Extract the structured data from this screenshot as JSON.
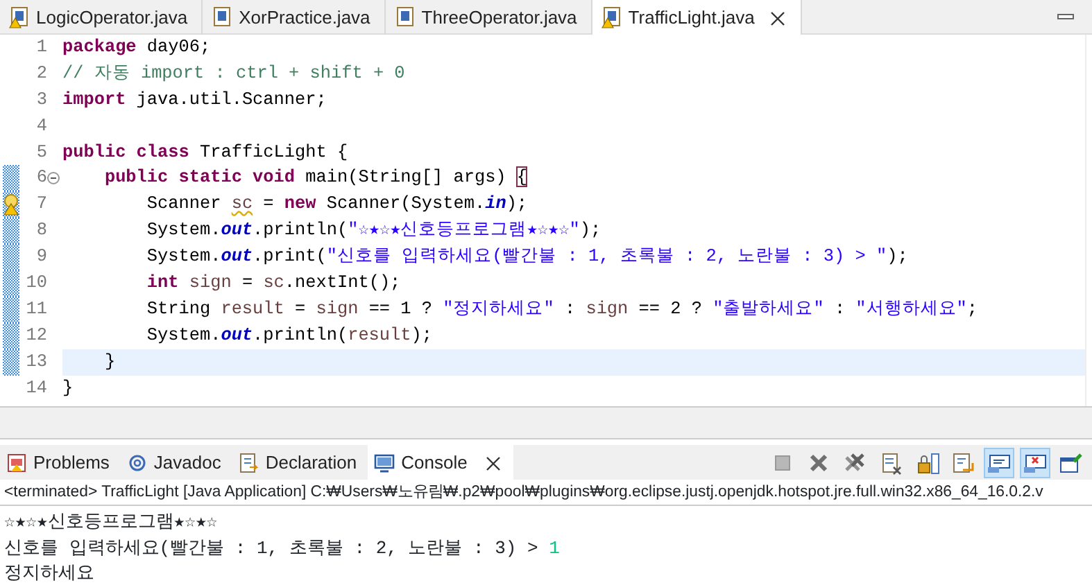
{
  "editor_tabs": [
    {
      "label": "LogicOperator.java",
      "warning": true,
      "selected": false,
      "closable": false
    },
    {
      "label": "XorPractice.java",
      "warning": false,
      "selected": false,
      "closable": false
    },
    {
      "label": "ThreeOperator.java",
      "warning": false,
      "selected": false,
      "closable": false
    },
    {
      "label": "TrafficLight.java",
      "warning": true,
      "selected": true,
      "closable": true
    }
  ],
  "code_lines": [
    {
      "number": "1",
      "changed": false,
      "current": false,
      "tokens": [
        {
          "kind": "keyword",
          "text": "package"
        },
        {
          "kind": "plain",
          "text": " day06;"
        }
      ]
    },
    {
      "number": "2",
      "changed": false,
      "current": false,
      "tokens": [
        {
          "kind": "comment",
          "text": "// 자동 import : ctrl + shift + 0"
        }
      ]
    },
    {
      "number": "3",
      "changed": false,
      "current": false,
      "tokens": [
        {
          "kind": "keyword",
          "text": "import"
        },
        {
          "kind": "plain",
          "text": " java.util.Scanner;"
        }
      ]
    },
    {
      "number": "4",
      "changed": false,
      "current": false
    },
    {
      "number": "5",
      "changed": false,
      "current": false,
      "tokens": [
        {
          "kind": "keyword",
          "text": "public class"
        },
        {
          "kind": "plain",
          "text": " TrafficLight {"
        }
      ],
      "children": [
        {
          "number": "6",
          "changed": true,
          "current": false,
          "foldable": true,
          "tokens": [
            {
              "kind": "keyword",
              "text": "public static void"
            },
            {
              "kind": "plain",
              "text": " main(String[] args) "
            },
            {
              "kind": "bracket-match",
              "text": "{"
            }
          ],
          "children": [
            {
              "number": "7",
              "changed": true,
              "current": false,
              "warning": true,
              "tokens": [
                {
                  "kind": "plain",
                  "text": "Scanner "
                },
                {
                  "kind": "local-warning",
                  "text": "sc"
                },
                {
                  "kind": "plain",
                  "text": " = "
                },
                {
                  "kind": "keyword",
                  "text": "new"
                },
                {
                  "kind": "plain",
                  "text": " Scanner(System."
                },
                {
                  "kind": "field",
                  "text": "in"
                },
                {
                  "kind": "plain",
                  "text": ");"
                }
              ]
            },
            {
              "number": "8",
              "changed": true,
              "current": false,
              "tokens": [
                {
                  "kind": "plain",
                  "text": "System."
                },
                {
                  "kind": "field",
                  "text": "out"
                },
                {
                  "kind": "plain",
                  "text": ".println("
                },
                {
                  "kind": "string",
                  "text": "\"☆★☆★신호등프로그램★☆★☆\""
                },
                {
                  "kind": "plain",
                  "text": ");"
                }
              ]
            },
            {
              "number": "9",
              "changed": true,
              "current": false,
              "tokens": [
                {
                  "kind": "plain",
                  "text": "System."
                },
                {
                  "kind": "field",
                  "text": "out"
                },
                {
                  "kind": "plain",
                  "text": ".print("
                },
                {
                  "kind": "string",
                  "text": "\"신호를 입력하세요(빨간불 : 1, 초록불 : 2, 노란불 : 3) > \""
                },
                {
                  "kind": "plain",
                  "text": ");"
                }
              ]
            },
            {
              "number": "10",
              "changed": true,
              "current": false,
              "tokens": [
                {
                  "kind": "keyword",
                  "text": "int "
                },
                {
                  "kind": "local",
                  "text": "sign"
                },
                {
                  "kind": "plain",
                  "text": " = "
                },
                {
                  "kind": "local",
                  "text": "sc"
                },
                {
                  "kind": "plain",
                  "text": ".nextInt();"
                }
              ]
            },
            {
              "number": "11",
              "changed": true,
              "current": false,
              "tokens": [
                {
                  "kind": "plain",
                  "text": "String "
                },
                {
                  "kind": "local",
                  "text": "result"
                },
                {
                  "kind": "plain",
                  "text": " = "
                },
                {
                  "kind": "local",
                  "text": "sign"
                },
                {
                  "kind": "plain",
                  "text": " == 1 ? "
                },
                {
                  "kind": "string",
                  "text": "\"정지하세요\""
                },
                {
                  "kind": "plain",
                  "text": " : "
                },
                {
                  "kind": "local",
                  "text": "sign"
                },
                {
                  "kind": "plain",
                  "text": " == 2 ? "
                },
                {
                  "kind": "string",
                  "text": "\"출발하세요\""
                },
                {
                  "kind": "plain",
                  "text": " : "
                },
                {
                  "kind": "string",
                  "text": "\"서행하세요\""
                },
                {
                  "kind": "plain",
                  "text": ";"
                }
              ]
            },
            {
              "number": "12",
              "changed": true,
              "current": false,
              "tokens": [
                {
                  "kind": "plain",
                  "text": "System."
                },
                {
                  "kind": "field",
                  "text": "out"
                },
                {
                  "kind": "plain",
                  "text": ".println("
                },
                {
                  "kind": "local",
                  "text": "result"
                },
                {
                  "kind": "plain",
                  "text": ");"
                }
              ]
            }
          ]
        },
        {
          "number": "13",
          "changed": true,
          "current": true,
          "tokens": [
            {
              "kind": "plain",
              "text": "}"
            }
          ]
        }
      ]
    },
    {
      "number": "14",
      "changed": false,
      "current": false,
      "tokens": [
        {
          "kind": "plain",
          "text": "}"
        }
      ]
    }
  ],
  "view_tabs": [
    {
      "label": "Problems",
      "kind": "problems",
      "selected": false,
      "closable": false
    },
    {
      "label": "Javadoc",
      "kind": "javadoc",
      "selected": false,
      "closable": false
    },
    {
      "label": "Declaration",
      "kind": "declaration",
      "selected": false,
      "closable": false
    },
    {
      "label": "Console",
      "kind": "console",
      "selected": true,
      "closable": true
    }
  ],
  "console_toolbar": [
    {
      "kind": "terminate",
      "pressed": false
    },
    {
      "kind": "remove",
      "pressed": false
    },
    {
      "kind": "remove-all",
      "pressed": false
    },
    {
      "kind": "clear",
      "pressed": false
    },
    {
      "kind": "scroll-lock",
      "pressed": false
    },
    {
      "kind": "word-wrap",
      "pressed": false
    },
    {
      "kind": "show-stdout",
      "pressed": true
    },
    {
      "kind": "show-stderr",
      "pressed": true
    },
    {
      "kind": "pin",
      "pressed": false
    }
  ],
  "console_status": "<terminated> TrafficLight [Java Application] C:₩Users₩노유림₩.p2₩pool₩plugins₩org.eclipse.justj.openjdk.hotspot.jre.full.win32.x86_64_16.0.2.v",
  "console_output": [
    {
      "segments": [
        {
          "kind": "output",
          "text": "☆★☆★신호등프로그램★☆★☆"
        }
      ]
    },
    {
      "segments": [
        {
          "kind": "output",
          "text": "신호를 입력하세요(빨간불 : 1, 초록불 : 2, 노란불 : 3) > "
        },
        {
          "kind": "input",
          "text": "1"
        }
      ]
    },
    {
      "segments": [
        {
          "kind": "output",
          "text": "정지하세요"
        }
      ]
    }
  ]
}
